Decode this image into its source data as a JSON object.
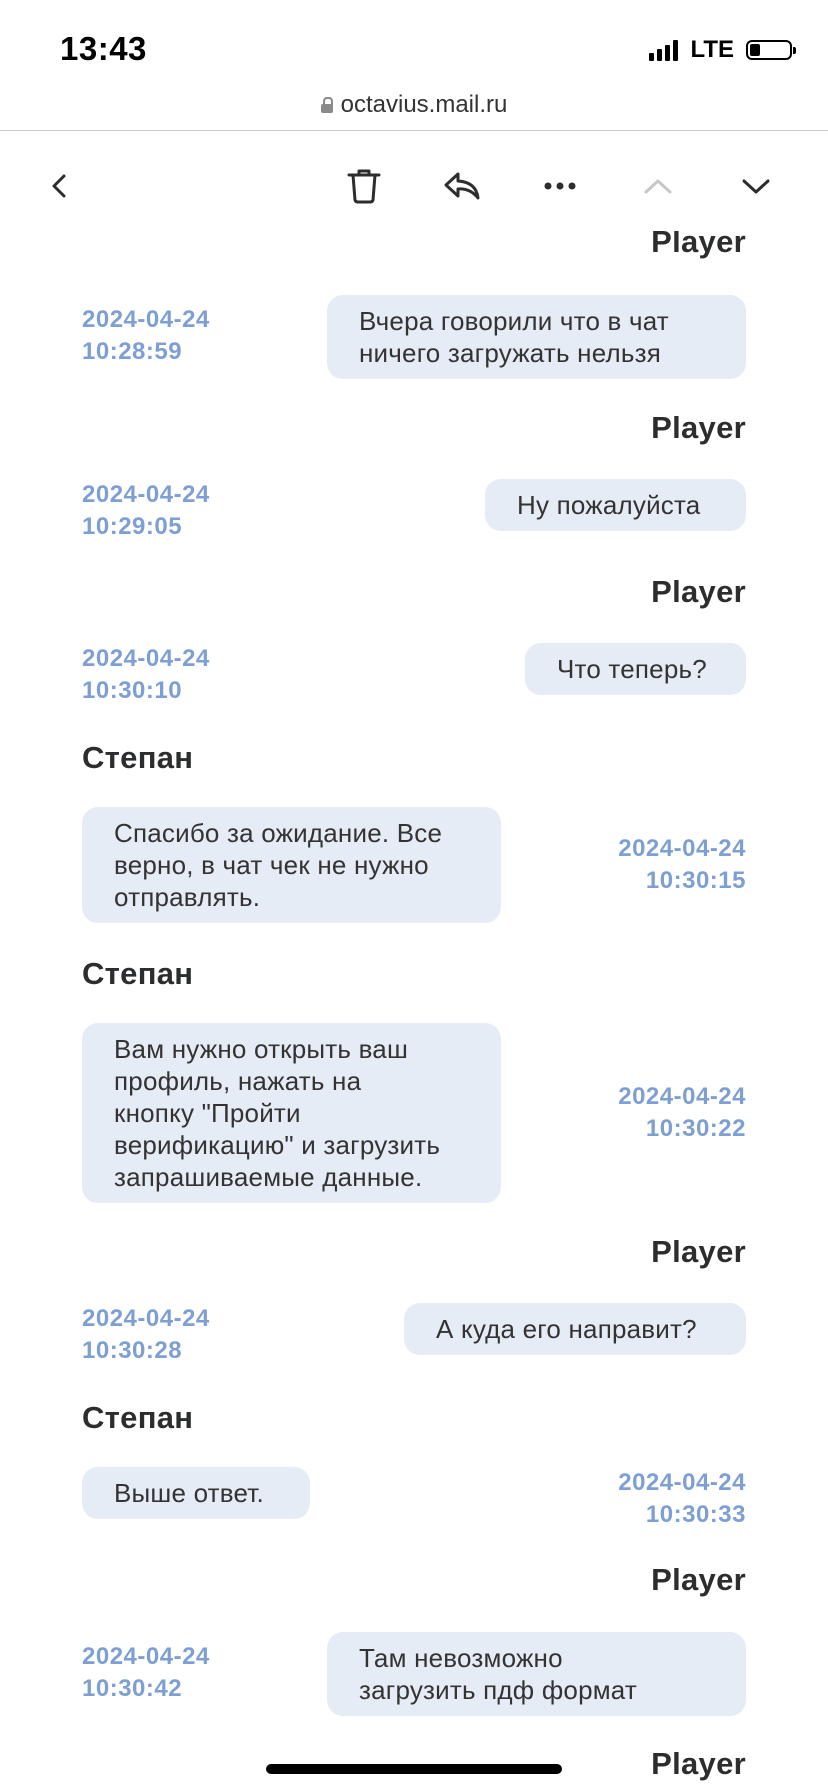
{
  "status_bar": {
    "time": "13:43",
    "network": "LTE"
  },
  "browser": {
    "url": "octavius.mail.ru"
  },
  "toolbar": {
    "icons": [
      "back-icon",
      "trash-icon",
      "reply-icon",
      "more-icon",
      "chevron-up-icon",
      "chevron-down-icon"
    ]
  },
  "messages": [
    {
      "sender": "Player",
      "date": "",
      "time": "",
      "text": ""
    },
    {
      "sender": "",
      "date": "2024-04-24",
      "time": "10:28:59",
      "text_lines": [
        "Вчера говорили что в чат",
        "ничего загружать нельзя"
      ]
    },
    {
      "sender": "Player",
      "date": "2024-04-24",
      "time": "10:29:05",
      "text_lines": [
        "Ну пожалуйста"
      ]
    },
    {
      "sender": "Player",
      "date": "2024-04-24",
      "time": "10:30:10",
      "text_lines": [
        "Что теперь?"
      ]
    },
    {
      "sender": "Степан",
      "date": "2024-04-24",
      "time": "10:30:15",
      "text_lines": [
        "Спасибо за ожидание. Все",
        "верно, в чат чек не нужно",
        "отправлять."
      ]
    },
    {
      "sender": "Степан",
      "date": "2024-04-24",
      "time": "10:30:22",
      "text_lines": [
        "Вам нужно открыть ваш",
        "профиль, нажать на",
        "кнопку \"Пройти",
        "верификацию\" и загрузить",
        "запрашиваемые данные."
      ]
    },
    {
      "sender": "Player",
      "date": "2024-04-24",
      "time": "10:30:28",
      "text_lines": [
        "А куда его направит?"
      ]
    },
    {
      "sender": "Степан",
      "date": "2024-04-24",
      "time": "10:30:33",
      "text_lines": [
        "Выше ответ."
      ]
    },
    {
      "sender": "Player",
      "date": "2024-04-24",
      "time": "10:30:42",
      "text_lines": [
        "Там невозможно",
        "загрузить пдф формат"
      ]
    },
    {
      "sender": "Player",
      "date": "",
      "time": "",
      "text_lines": []
    }
  ],
  "colors": {
    "bubble_bg": "#e6ecf6",
    "timestamp": "#7d9fd3",
    "sender": "#2c2d2e"
  }
}
